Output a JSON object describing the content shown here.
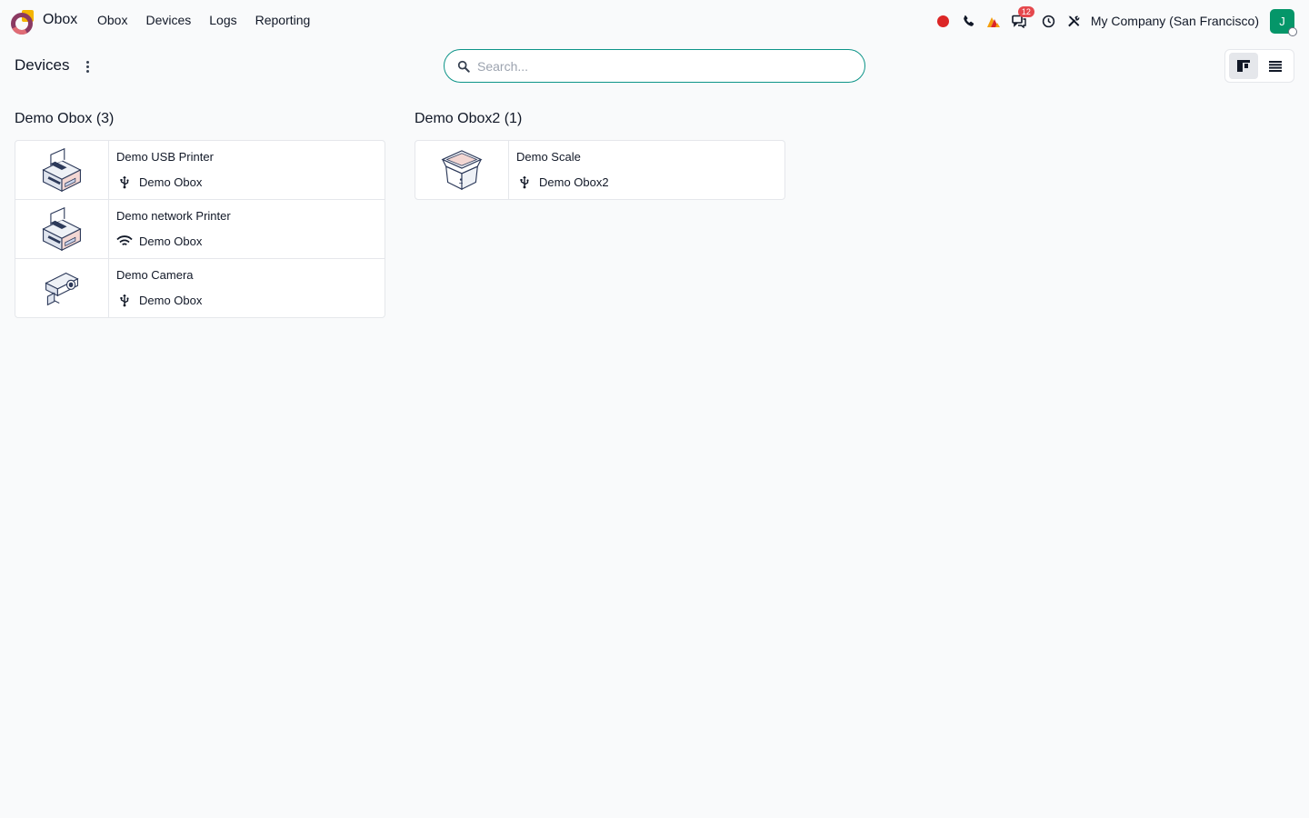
{
  "app": {
    "name": "Obox",
    "menu": [
      {
        "label": "Obox"
      },
      {
        "label": "Devices"
      },
      {
        "label": "Logs"
      },
      {
        "label": "Reporting"
      }
    ]
  },
  "systray": {
    "message_count": "12",
    "company": "My Company (San Francisco)",
    "avatar_initial": "J",
    "colors": {
      "record": "#dc2626",
      "avatar": "#059669",
      "badge": "#e5484d"
    }
  },
  "control_panel": {
    "breadcrumb": "Devices",
    "search_placeholder": "Search..."
  },
  "groups": [
    {
      "title": "Demo Obox (3)",
      "cards": [
        {
          "name": "Demo USB Printer",
          "connection_icon": "usb-icon",
          "obox": "Demo Obox",
          "image": "printer"
        },
        {
          "name": "Demo network Printer",
          "connection_icon": "wifi-icon",
          "obox": "Demo Obox",
          "image": "printer"
        },
        {
          "name": "Demo Camera",
          "connection_icon": "usb-icon",
          "obox": "Demo Obox",
          "image": "camera"
        }
      ]
    },
    {
      "title": "Demo Obox2 (1)",
      "cards": [
        {
          "name": "Demo Scale",
          "connection_icon": "usb-icon",
          "obox": "Demo Obox2",
          "image": "scale"
        }
      ]
    }
  ]
}
